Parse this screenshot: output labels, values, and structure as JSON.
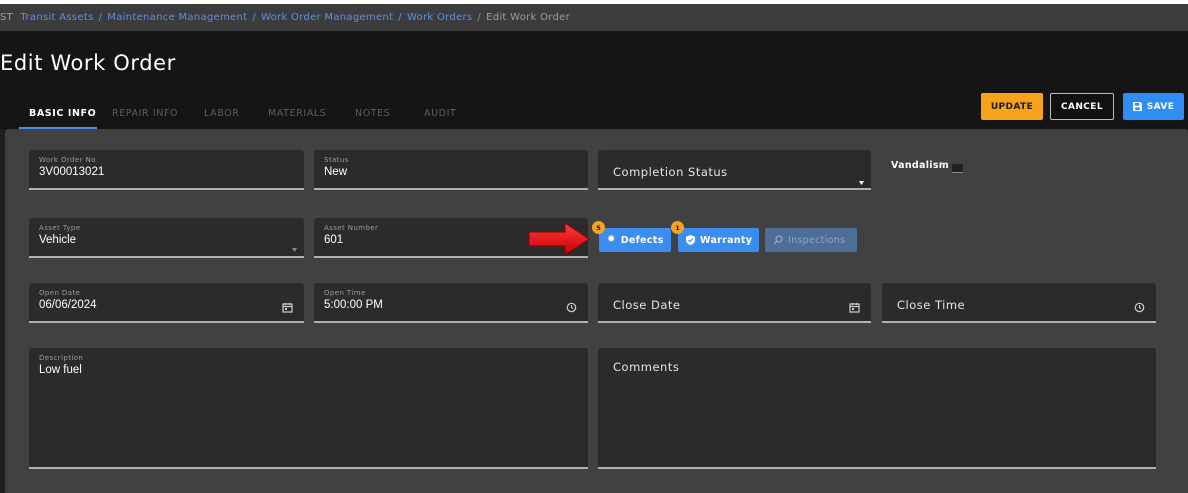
{
  "breadcrumb": {
    "prefix": "ST",
    "items": [
      "Transit Assets",
      "Maintenance Management",
      "Work Order Management",
      "Work Orders"
    ],
    "current": "Edit Work Order",
    "separator": "/"
  },
  "page_title": "Edit Work Order",
  "tabs": [
    {
      "label": "BASIC INFO",
      "active": true
    },
    {
      "label": "REPAIR INFO",
      "active": false
    },
    {
      "label": "LABOR",
      "active": false
    },
    {
      "label": "MATERIALS",
      "active": false
    },
    {
      "label": "NOTES",
      "active": false
    },
    {
      "label": "AUDIT",
      "active": false
    }
  ],
  "toolbar": {
    "update_label": "UPDATE",
    "cancel_label": "CANCEL",
    "save_label": "SAVE"
  },
  "form": {
    "work_order_no": {
      "label": "Work Order No",
      "value": "3V00013021"
    },
    "status": {
      "label": "Status",
      "value": "New"
    },
    "completion_status": {
      "placeholder": "Completion Status"
    },
    "vandalism": {
      "label": "Vandalism",
      "checked": false
    },
    "asset_type": {
      "label": "Asset Type",
      "value": "Vehicle"
    },
    "asset_number": {
      "label": "Asset Number",
      "value": "601"
    },
    "open_date": {
      "label": "Open Date",
      "value": "06/06/2024"
    },
    "open_time": {
      "label": "Open Time",
      "value": "5:00:00 PM"
    },
    "close_date": {
      "placeholder": "Close Date"
    },
    "close_time": {
      "placeholder": "Close Time"
    },
    "description": {
      "label": "Description",
      "value": "Low fuel"
    },
    "comments": {
      "placeholder": "Comments"
    }
  },
  "actions": {
    "defects": {
      "label": "Defects",
      "badge": "5"
    },
    "warranty": {
      "label": "Warranty",
      "badge": "1"
    },
    "inspections": {
      "label": "Inspections"
    }
  },
  "colors": {
    "accent": "#2f8df5",
    "update": "#f6a21a",
    "badge": "#f6a21a",
    "arrow": "#e00000"
  }
}
